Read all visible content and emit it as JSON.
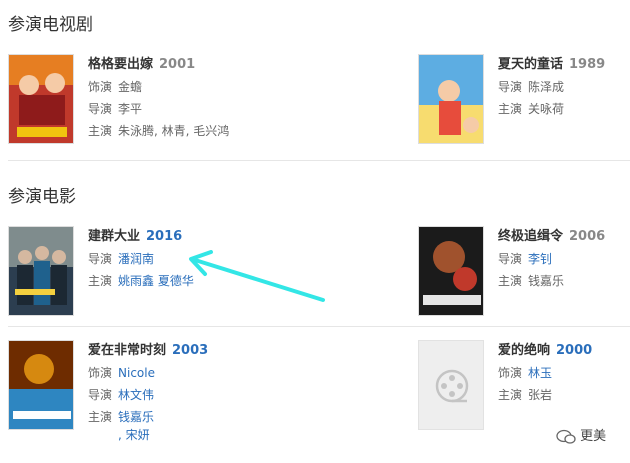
{
  "tv": {
    "section_title": "参演电视剧",
    "items": [
      {
        "title": "格格要出嫁",
        "year": "2001",
        "rows": [
          {
            "label": "饰演",
            "value": "金蟾"
          },
          {
            "label": "导演",
            "value": "李平"
          },
          {
            "label": "主演",
            "value": "朱泳腾, 林青, 毛兴鸿"
          }
        ]
      },
      {
        "title": "夏天的童话",
        "year": "1989",
        "rows": [
          {
            "label": "导演",
            "value": "陈泽成"
          },
          {
            "label": "主演",
            "value": "关咏荷"
          }
        ]
      }
    ]
  },
  "film": {
    "section_title": "参演电影",
    "items": [
      {
        "title": "建群大业",
        "year": "2016",
        "rows": [
          {
            "label": "导演",
            "value": "潘润南"
          },
          {
            "label": "主演",
            "value": "姚雨鑫 夏德华"
          }
        ]
      },
      {
        "title": "终极追缉令",
        "year": "2006",
        "rows": [
          {
            "label": "导演",
            "value": "李钊"
          },
          {
            "label": "主演",
            "value": "钱嘉乐"
          }
        ]
      },
      {
        "title": "爱在非常时刻",
        "year": "2003",
        "rows": [
          {
            "label": "饰演",
            "value": "Nicole"
          },
          {
            "label": "导演",
            "value": "林文伟"
          },
          {
            "label": "主演",
            "value": "钱嘉乐",
            "extra": ", 宋妍"
          }
        ]
      },
      {
        "title": "爱的绝响",
        "year": "2000",
        "rows": [
          {
            "label": "饰演",
            "value": "林玉"
          },
          {
            "label": "主演",
            "value": "张岩"
          }
        ]
      }
    ]
  },
  "watermark": "更美"
}
